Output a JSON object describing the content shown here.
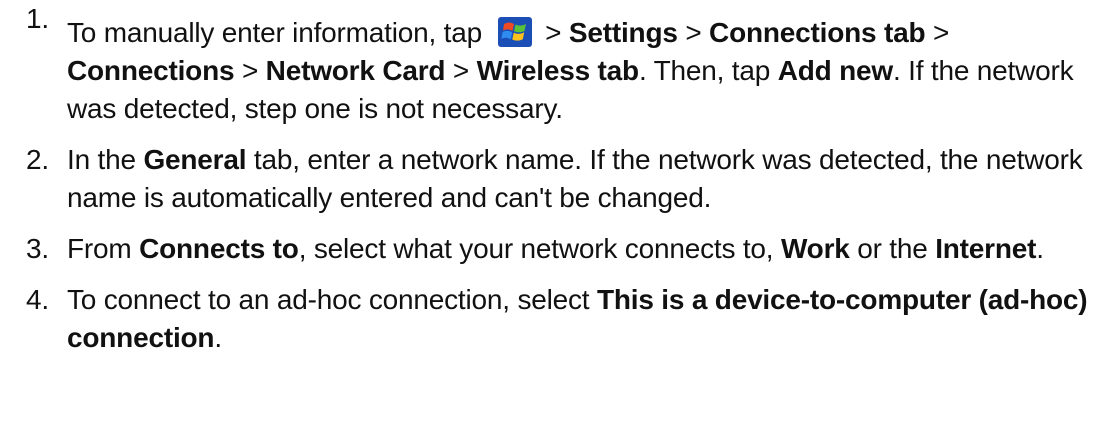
{
  "steps": [
    {
      "number": "1.",
      "t1": "To manually enter information, tap ",
      "t2": " > ",
      "b1": "Settings",
      "t3": " > ",
      "b2": "Connections tab",
      "t4": " > ",
      "b3": "Connections",
      "t5": " > ",
      "b4": "Network Card",
      "t6": " > ",
      "b5": "Wireless tab",
      "t7": ". Then, tap ",
      "b6": "Add new",
      "t8": ". If the network was detected, step one is not necessary.",
      "icon": "windows-start-icon"
    },
    {
      "number": "2.",
      "t1": "In the ",
      "b1": "General",
      "t2": " tab, enter a network name. If the network was detected, the network name is automatically entered and can't be changed."
    },
    {
      "number": "3.",
      "t1": "From ",
      "b1": "Connects to",
      "t2": ", select what your network connects to, ",
      "b2": "Work",
      "t3": " or the ",
      "b3": "Internet",
      "t4": "."
    },
    {
      "number": "4.",
      "t1": "To connect to an ad-hoc connection, select ",
      "b1": "This is a device-to-computer (ad-hoc) connection",
      "t2": "."
    }
  ]
}
